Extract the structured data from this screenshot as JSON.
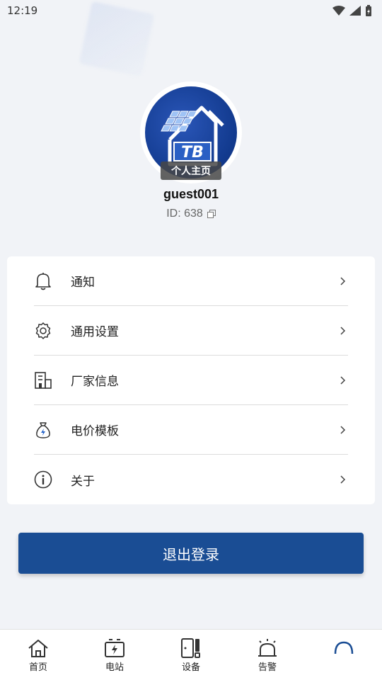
{
  "status_bar": {
    "time": "12:19"
  },
  "profile": {
    "avatar_badge": "个人主页",
    "avatar_logo_text": "TB",
    "username": "guest001",
    "user_id": "ID: 638"
  },
  "menu": {
    "items": [
      {
        "label": "通知",
        "icon": "bell-icon"
      },
      {
        "label": "通用设置",
        "icon": "gear-icon"
      },
      {
        "label": "厂家信息",
        "icon": "building-icon"
      },
      {
        "label": "电价模板",
        "icon": "money-bag-icon"
      },
      {
        "label": "关于",
        "icon": "info-icon"
      }
    ]
  },
  "logout_label": "退出登录",
  "nav": {
    "items": [
      {
        "label": "首页",
        "icon": "home-icon"
      },
      {
        "label": "电站",
        "icon": "power-station-icon"
      },
      {
        "label": "设备",
        "icon": "device-icon"
      },
      {
        "label": "告警",
        "icon": "alarm-icon"
      },
      {
        "label": "",
        "icon": "profile-icon",
        "active": true
      }
    ]
  },
  "colors": {
    "accent": "#1a4d94",
    "background": "#f1f3f7"
  }
}
